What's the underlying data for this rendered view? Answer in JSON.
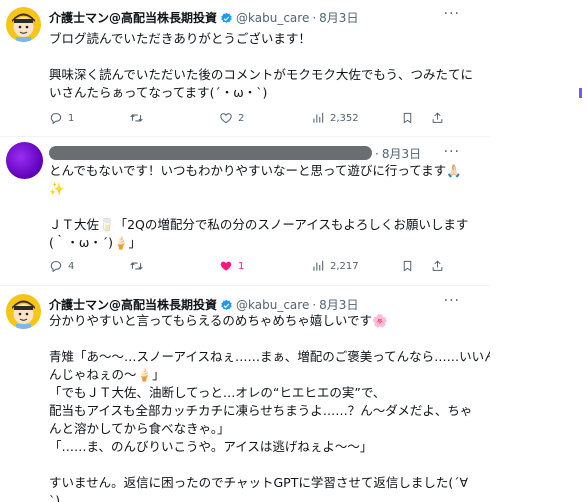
{
  "tweets": [
    {
      "name": "介護士マン@高配当株長期投資",
      "handle": "@kabu_care",
      "sep": "·",
      "date": "8月3日",
      "body": [
        "ブログ読んでいただきありがとうございます！",
        "",
        "興味深く読んでいただいた後のコメントがモクモク大佐でもう、つみたてに",
        "いさんたらぁってなってます(´・ω・`)"
      ],
      "stats": {
        "replies": "1",
        "retweets": "",
        "likes": "2",
        "views": "2,352"
      },
      "liked": false
    },
    {
      "name": "",
      "handle": "",
      "sep": "·",
      "date": "8月3日",
      "body": [
        "とんでもないです！いつもわかりやすいなーと思って遊びに行ってます🙏🏻",
        "✨",
        "",
        "ＪＴ大佐🥛「2Qの増配分で私の分のスノーアイスもよろしくお願いします",
        "(｀・ω・´)🍦」"
      ],
      "stats": {
        "replies": "4",
        "retweets": "",
        "likes": "1",
        "views": "2,217"
      },
      "liked": true
    },
    {
      "name": "介護士マン@高配当株長期投資",
      "handle": "@kabu_care",
      "sep": "·",
      "date": "8月3日",
      "body": [
        "分かりやすいと言ってもらえるのめちゃめちゃ嬉しいです🌸",
        "",
        "青雉「あ〜〜…スノーアイスねぇ……まぁ、増配のご褒美ってんなら……いいん",
        "んじゃねぇの〜🍦」",
        "「でもＪＴ大佐、油断してっと…オレの“ヒエヒエの実”で、",
        "配当もアイスも全部カッチカチに凍らせちまうよ……？ん〜ダメだよ、ちゃ",
        "んと溶かしてから食べなきゃ。」",
        "「……ま、のんびりいこうや。アイスは逃げねぇよ〜〜」",
        "",
        "すいません。返信に困ったのでチャットGPTに学習させて返信しました(´∀",
        "`)"
      ]
    }
  ],
  "icons": {
    "verified": "verified-badge-icon",
    "more": "more-options-icon",
    "reply": "reply-icon",
    "retweet": "retweet-icon",
    "like": "like-icon",
    "views": "views-icon",
    "bookmark": "bookmark-icon"
  },
  "colors": {
    "verified": "#1d9bf0",
    "muted": "#536471",
    "like": "#f91880",
    "divider": "#eff3f4",
    "redacted": "#6b6e70",
    "side_mark": "#7856ff"
  }
}
